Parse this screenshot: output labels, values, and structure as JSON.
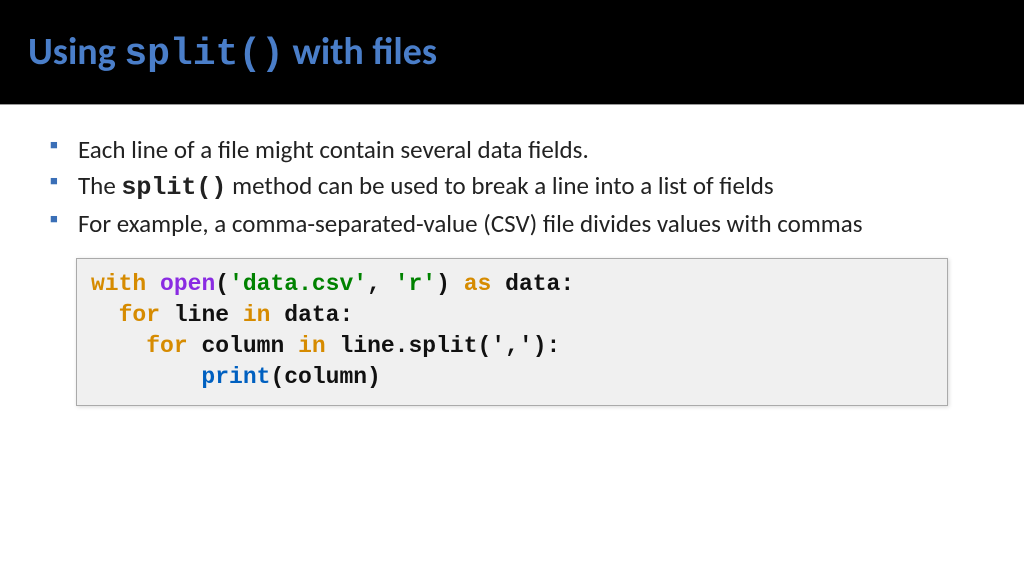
{
  "header": {
    "title_pre": "Using ",
    "title_code": "split()",
    "title_post": " with files"
  },
  "bullets": {
    "b1": "Each line of a file might contain several data fields.",
    "b2_pre": "The ",
    "b2_code": "split()",
    "b2_post": " method can be used to break a line into a list of fields",
    "b3": "For example, a comma-separated-value (CSV) file divides values with commas"
  },
  "code": {
    "l1_with": "with",
    "l1_open": "open",
    "l1_p1": "(",
    "l1_s1": "'data.csv'",
    "l1_comma": ", ",
    "l1_s2": "'r'",
    "l1_p2": ") ",
    "l1_as": "as",
    "l1_rest": " data:",
    "l2_indent": "  ",
    "l2_for": "for",
    "l2_mid": " line ",
    "l2_in": "in",
    "l2_rest": " data:",
    "l3_indent": "    ",
    "l3_for": "for",
    "l3_mid": " column ",
    "l3_in": "in",
    "l3_rest": " line.split(',')",
    "l3_colon": ":",
    "l4_indent": "        ",
    "l4_print": "print",
    "l4_rest": "(column)"
  }
}
